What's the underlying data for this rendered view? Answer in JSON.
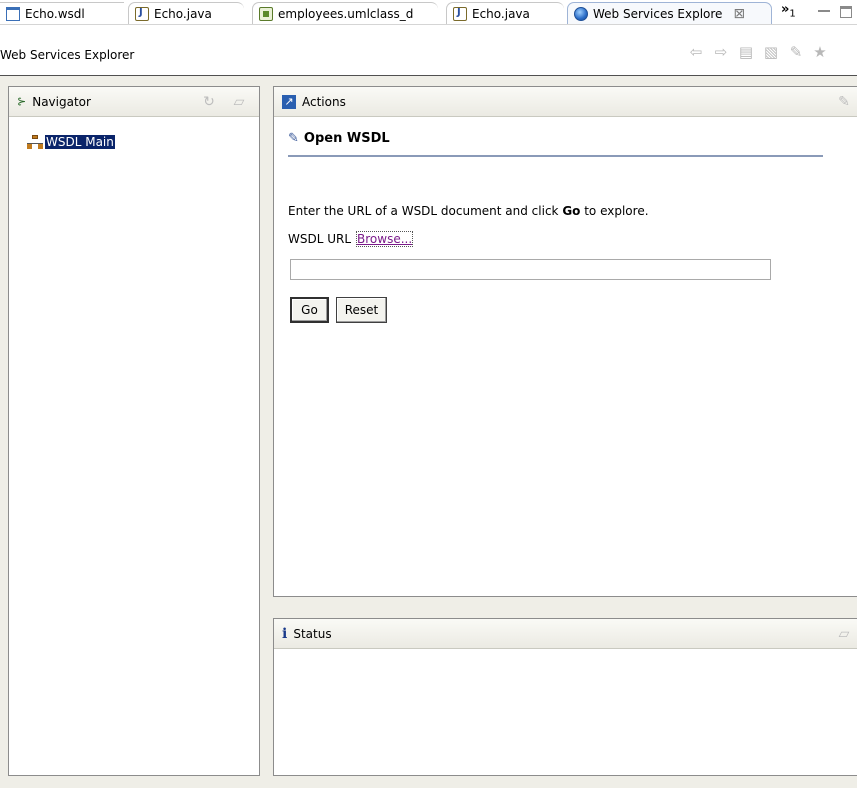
{
  "tabs": [
    {
      "label": "Echo.wsdl",
      "icon": "wsdl-file-icon"
    },
    {
      "label": "Echo.java",
      "icon": "java-file-icon"
    },
    {
      "label": "employees.umlclass_d",
      "icon": "uml-class-diagram-icon"
    },
    {
      "label": "Echo.java",
      "icon": "java-file-icon"
    },
    {
      "label": "Web Services Explore",
      "icon": "globe-icon",
      "close": "⊠"
    }
  ],
  "overflow": {
    "symbol": "»",
    "count": "1"
  },
  "editor_title": "Web Services Explorer",
  "navigator": {
    "title": "Navigator",
    "tree_item": "WSDL Main"
  },
  "actions": {
    "title": "Actions",
    "section_title": "Open WSDL",
    "instruction_before": "Enter the URL of a WSDL document and click ",
    "instruction_bold": "Go",
    "instruction_after": " to explore.",
    "url_label": "WSDL URL",
    "browse_label": "Browse...",
    "url_value": "",
    "go_label": "Go",
    "reset_label": "Reset"
  },
  "status": {
    "title": "Status"
  },
  "colors": {
    "selection": "#0a246a",
    "panel_border": "#8c8c8c",
    "body_bg": "#efeee7",
    "link": "#7a1a8a"
  }
}
